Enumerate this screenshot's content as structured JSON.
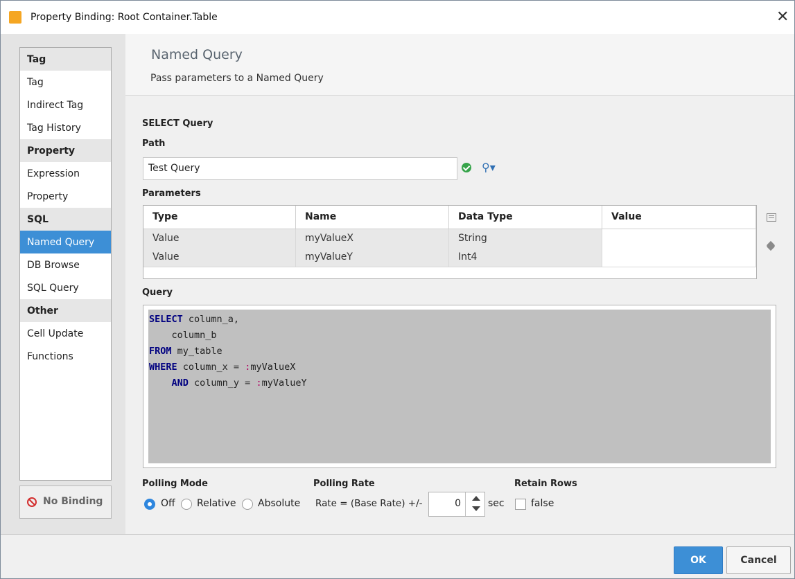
{
  "window": {
    "title": "Property Binding: Root Container.Table",
    "close_glyph": "✕"
  },
  "sidebar": {
    "groups": [
      {
        "label": "Tag",
        "items": [
          "Tag",
          "Indirect Tag",
          "Tag History"
        ]
      },
      {
        "label": "Property",
        "items": [
          "Expression",
          "Property"
        ]
      },
      {
        "label": "SQL",
        "items": [
          "Named Query",
          "DB Browse",
          "SQL Query"
        ]
      },
      {
        "label": "Other",
        "items": [
          "Cell Update",
          "Functions"
        ]
      }
    ],
    "selected": "Named Query",
    "no_binding_label": "No Binding"
  },
  "header": {
    "title": "Named Query",
    "subtitle": "Pass parameters to a Named Query"
  },
  "select_query": {
    "section_label": "SELECT Query",
    "path_label": "Path",
    "path_value": "Test Query",
    "parameters_label": "Parameters",
    "columns": [
      "Type",
      "Name",
      "Data Type",
      "Value"
    ],
    "rows": [
      [
        "Value",
        "myValueX",
        "String",
        ""
      ],
      [
        "Value",
        "myValueY",
        "Int4",
        ""
      ]
    ],
    "query_label": "Query",
    "query_lines": [
      [
        {
          "k": "kw",
          "t": "SELECT"
        },
        {
          "k": "",
          "t": " column_a,"
        }
      ],
      [
        {
          "k": "",
          "t": "    column_b"
        }
      ],
      [
        {
          "k": "kw",
          "t": "FROM"
        },
        {
          "k": "",
          "t": " my_table"
        }
      ],
      [
        {
          "k": "kw",
          "t": "WHERE"
        },
        {
          "k": "",
          "t": " column_x = "
        },
        {
          "k": "prm",
          "t": ":"
        },
        {
          "k": "",
          "t": "myValueX"
        }
      ],
      [
        {
          "k": "",
          "t": "    "
        },
        {
          "k": "kw",
          "t": "AND"
        },
        {
          "k": "",
          "t": " column_y = "
        },
        {
          "k": "prm",
          "t": ":"
        },
        {
          "k": "",
          "t": "myValueY"
        }
      ]
    ]
  },
  "polling": {
    "mode_label": "Polling Mode",
    "modes": [
      "Off",
      "Relative",
      "Absolute"
    ],
    "selected_mode": "Off",
    "rate_label": "Polling Rate",
    "rate_prefix": "Rate = (Base Rate) +/-",
    "rate_value": "0",
    "rate_unit": "sec",
    "retain_label": "Retain Rows",
    "retain_value": "false"
  },
  "footer": {
    "ok_label": "OK",
    "cancel_label": "Cancel"
  },
  "colors": {
    "accent": "#3d8fd6",
    "keyword": "#000080",
    "param_marker": "#b00060",
    "ok_green": "#36a44a"
  }
}
